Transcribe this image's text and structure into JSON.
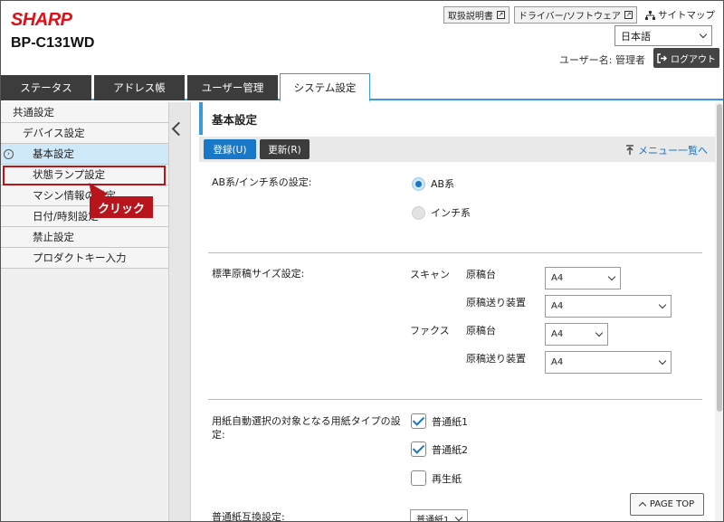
{
  "header": {
    "brand": "SHARP",
    "model": "BP-C131WD",
    "links": [
      {
        "label": "取扱説明書",
        "icon": "external-link-icon"
      },
      {
        "label": "ドライバー/ソフトウェア",
        "icon": "external-link-icon"
      }
    ],
    "sitemap_label": "サイトマップ",
    "language_selected": "日本語",
    "user_line": "ユーザー名: 管理者",
    "logout_label": "ログアウト"
  },
  "tabs": [
    {
      "label": "ステータス",
      "active": false
    },
    {
      "label": "アドレス帳",
      "active": false
    },
    {
      "label": "ユーザー管理",
      "active": false
    },
    {
      "label": "システム設定",
      "active": true
    }
  ],
  "sidebar": {
    "items": [
      {
        "label": "共通設定",
        "level": 1
      },
      {
        "label": "デバイス設定",
        "level": 2
      },
      {
        "label": "基本設定",
        "level": 3,
        "selected": true
      },
      {
        "label": "状態ランプ設定",
        "level": 3
      },
      {
        "label": "マシン情報の設定",
        "level": 3
      },
      {
        "label": "日付/時刻設定",
        "level": 3
      },
      {
        "label": "禁止設定",
        "level": 3
      },
      {
        "label": "プロダクトキー入力",
        "level": 3
      }
    ],
    "annotation_label": "クリック"
  },
  "content": {
    "title": "基本設定",
    "register_label": "登録(U)",
    "refresh_label": "更新(R)",
    "menu_link_label": "メニュー一覧へ",
    "ab_inch": {
      "label": "AB系/インチ系の設定:",
      "options": [
        {
          "label": "AB系",
          "selected": true
        },
        {
          "label": "インチ系",
          "selected": false
        }
      ]
    },
    "original_size": {
      "label": "標準原稿サイズ設定:",
      "scan_label": "スキャン",
      "fax_label": "ファクス",
      "platen_label": "原稿台",
      "feeder_label": "原稿送り装置",
      "scan_platen_value": "A4",
      "scan_feeder_value": "A4",
      "fax_platen_value": "A4",
      "fax_feeder_value": "A4"
    },
    "paper_type": {
      "label": "用紙自動選択の対象となる用紙タイプの設定:",
      "options": [
        {
          "label": "普通紙1",
          "checked": true
        },
        {
          "label": "普通紙2",
          "checked": true
        },
        {
          "label": "再生紙",
          "checked": false
        }
      ]
    },
    "plain_paper_swap": {
      "label": "普通紙互換設定:",
      "value": "普通紙1"
    },
    "page_top_label": "PAGE TOP"
  },
  "colors": {
    "brand_red": "#e01019",
    "accent_blue": "#1877c6",
    "annotation_red": "#b7141c"
  }
}
